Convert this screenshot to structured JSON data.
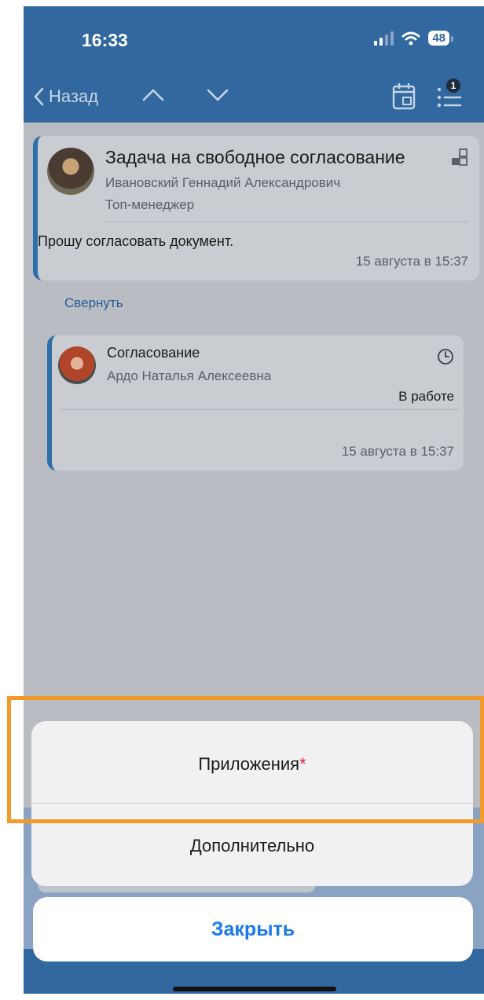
{
  "status_bar": {
    "time": "16:33",
    "battery": "48"
  },
  "nav": {
    "back_label": "Назад",
    "badge_count": "1"
  },
  "task_card": {
    "title": "Задача на свободное согласование",
    "author": "Ивановский Геннадий Александрович",
    "role": "Топ-менеджер",
    "message": "Прошу согласовать документ.",
    "date": "15 августа в 15:37"
  },
  "collapse_label": "Свернуть",
  "approval_card": {
    "title": "Согласование",
    "person": "Ардо Наталья Алексеевна",
    "status": "В работе",
    "date": "15 августа в 15:37"
  },
  "action_sheet": {
    "items": [
      {
        "label": "Приложения",
        "required_mark": "*"
      },
      {
        "label": "Дополнительно"
      }
    ],
    "close_label": "Закрыть"
  },
  "colors": {
    "header": "#31689f",
    "accent": "#2f6ea8",
    "close_button_text": "#1a7aeb",
    "highlight": "#f39a2b",
    "required": "#e0262f"
  }
}
